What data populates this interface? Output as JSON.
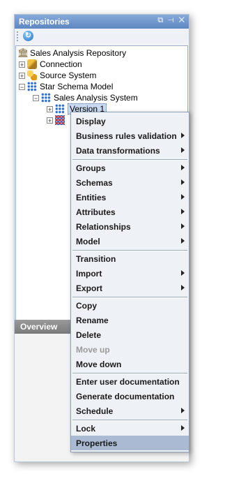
{
  "panel": {
    "title": "Repositories",
    "window_controls": "⧉ ⊣ ✕",
    "refresh_icon": "refresh-icon",
    "overview_tab": "Overview"
  },
  "tree": [
    {
      "label": "Sales Analysis Repository",
      "icon": "repository-icon",
      "expander": ""
    },
    {
      "label": "Connection",
      "icon": "connection-icon",
      "expander": "+"
    },
    {
      "label": "Source System",
      "icon": "source-system-icon",
      "expander": "+"
    },
    {
      "label": "Star Schema Model",
      "icon": "model-icon",
      "expander": "−"
    },
    {
      "label": "Sales Analysis System",
      "icon": "system-icon",
      "expander": "−"
    },
    {
      "label": "Version 1",
      "icon": "version-icon",
      "expander": "+",
      "selected": true
    },
    {
      "label": "",
      "icon": "version-icon",
      "expander": "+"
    }
  ],
  "context_menu": {
    "items": [
      {
        "label": "Display",
        "submenu": false
      },
      {
        "label": "Business rules validation",
        "submenu": true
      },
      {
        "label": "Data transformations",
        "submenu": true
      },
      {
        "label": "Groups",
        "submenu": true
      },
      {
        "label": "Schemas",
        "submenu": true
      },
      {
        "label": "Entities",
        "submenu": true
      },
      {
        "label": "Attributes",
        "submenu": true
      },
      {
        "label": "Relationships",
        "submenu": true
      },
      {
        "label": "Model",
        "submenu": true
      },
      {
        "label": "Transition",
        "submenu": false
      },
      {
        "label": "Import",
        "submenu": true
      },
      {
        "label": "Export",
        "submenu": true
      },
      {
        "label": "Copy",
        "submenu": false
      },
      {
        "label": "Rename",
        "submenu": false
      },
      {
        "label": "Delete",
        "submenu": false
      },
      {
        "label": "Move up",
        "submenu": false,
        "disabled": true
      },
      {
        "label": "Move down",
        "submenu": false
      },
      {
        "label": "Enter user documentation",
        "submenu": false
      },
      {
        "label": "Generate documentation",
        "submenu": false
      },
      {
        "label": "Schedule",
        "submenu": true
      },
      {
        "label": "Lock",
        "submenu": true
      },
      {
        "label": "Properties",
        "submenu": false,
        "highlighted": true
      }
    ]
  },
  "colors": {
    "title_bar": "#6f97cc",
    "highlight": "#a9bad2",
    "disabled_text": "#9a9a9a"
  }
}
